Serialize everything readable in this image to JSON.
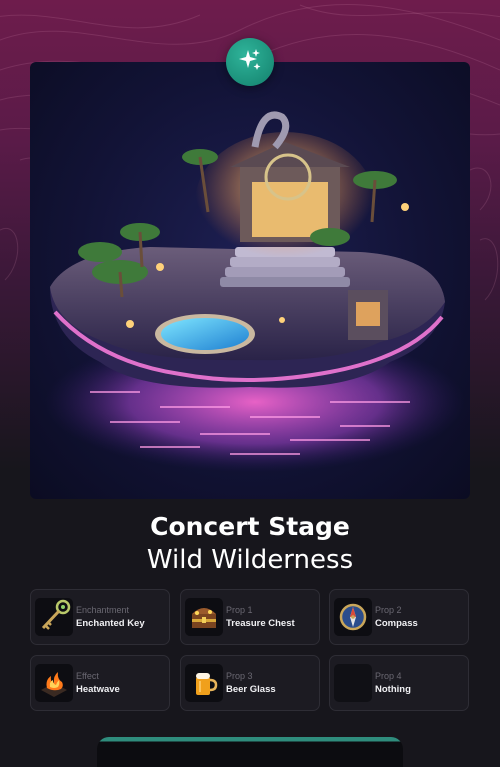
{
  "header": {
    "badge_icon": "sparkles-icon",
    "badge_color": "#1e9b83"
  },
  "hero": {
    "image_icon": "floating-island-concert-stage-image"
  },
  "item": {
    "title": "Concert Stage",
    "subtitle": "Wild Wilderness"
  },
  "slots": [
    {
      "label": "Enchantment",
      "value": "Enchanted Key",
      "icon": "key-icon"
    },
    {
      "label": "Prop 1",
      "value": "Treasure Chest",
      "icon": "treasure-chest-icon"
    },
    {
      "label": "Prop 2",
      "value": "Compass",
      "icon": "compass-icon"
    },
    {
      "label": "Effect",
      "value": "Heatwave",
      "icon": "heatwave-icon"
    },
    {
      "label": "Prop 3",
      "value": "Beer Glass",
      "icon": "beer-glass-icon"
    },
    {
      "label": "Prop 4",
      "value": "Nothing",
      "icon": "empty-slot-icon"
    }
  ],
  "footer": {
    "accent_color": "#2f8d7d"
  }
}
